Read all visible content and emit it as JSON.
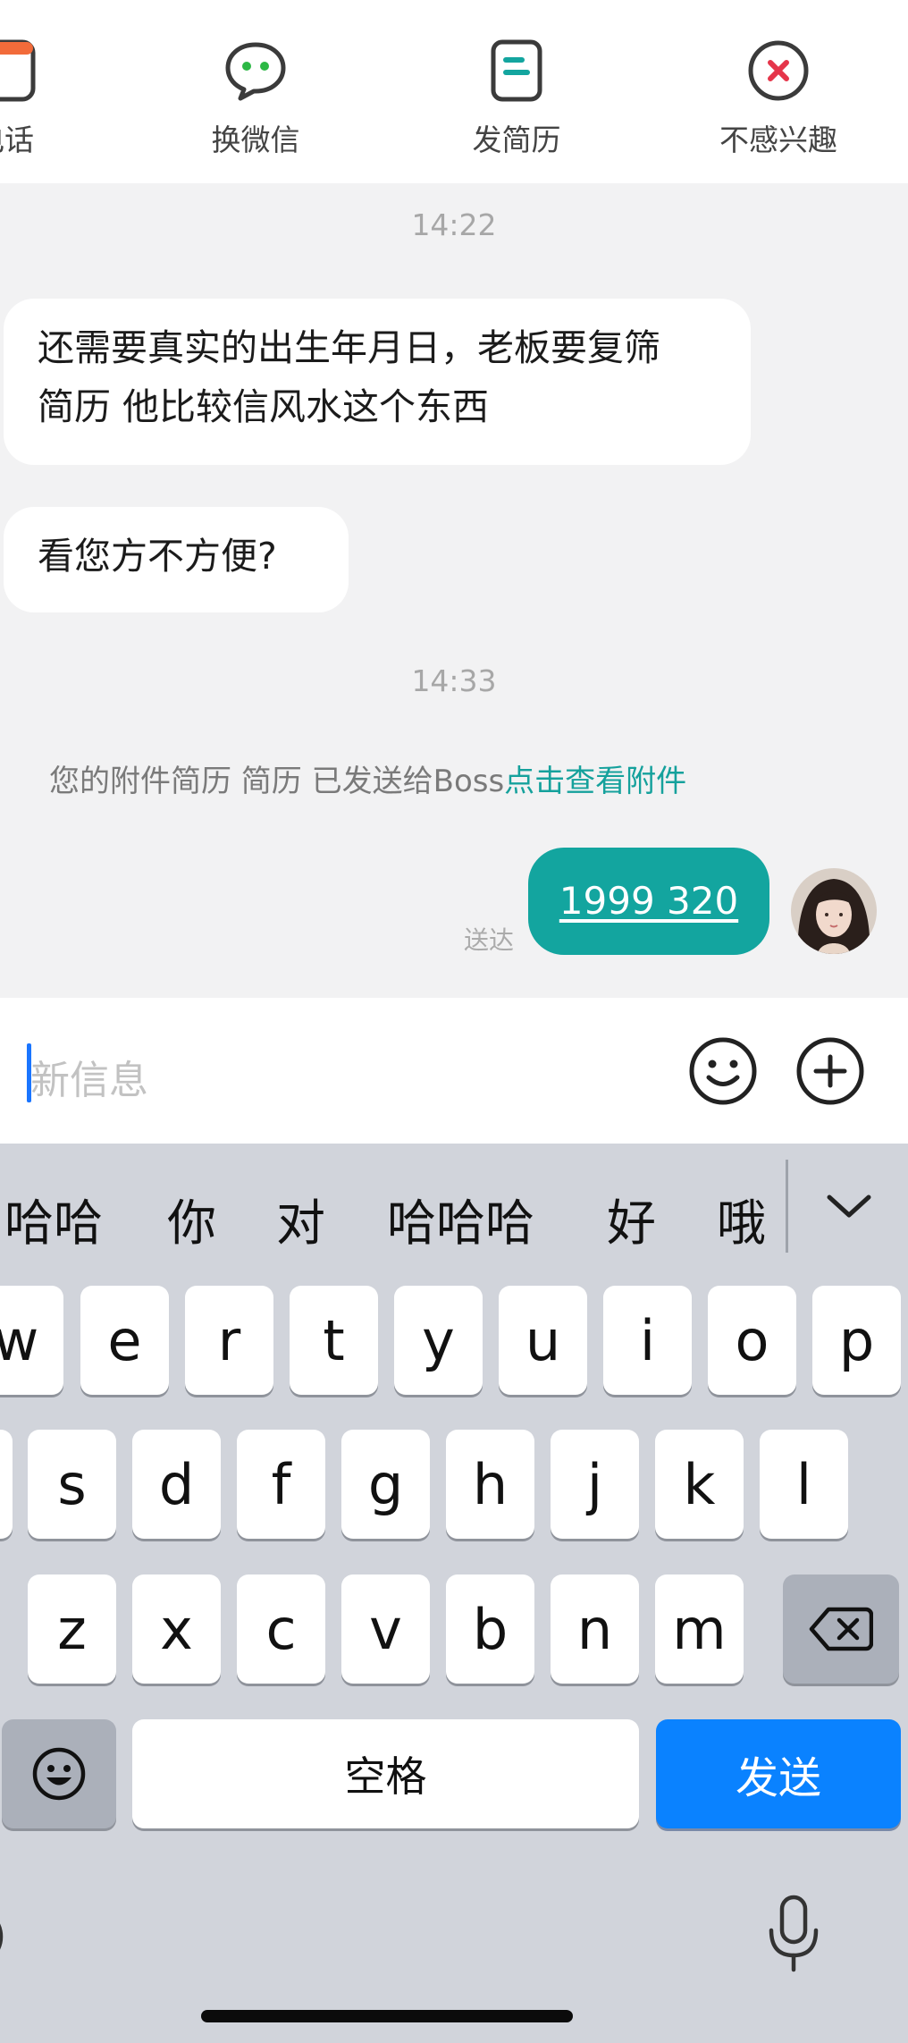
{
  "toolbar": {
    "items": [
      {
        "label": "电话"
      },
      {
        "label": "换微信"
      },
      {
        "label": "发简历"
      },
      {
        "label": "不感兴趣"
      }
    ]
  },
  "chat": {
    "time1": "14:22",
    "msg1_line1": "还需要真实的出生年月日，老板要复筛",
    "msg1_line2": "简历  他比较信风水这个东西",
    "msg2": "看您方不方便?",
    "time2": "14:33",
    "system_text": "您的附件简历 简历 已发送给Boss",
    "system_link": "点击查看附件",
    "my_msg": "1999 320",
    "my_status": "送达"
  },
  "input": {
    "placeholder": "新信息"
  },
  "keyboard": {
    "candidates": [
      "哈哈",
      "你",
      "对",
      "哈哈哈",
      "好",
      "哦"
    ],
    "row1": [
      "w",
      "e",
      "r",
      "t",
      "y",
      "u",
      "i",
      "o",
      "p"
    ],
    "row2": [
      "s",
      "d",
      "f",
      "g",
      "h",
      "j",
      "k",
      "l"
    ],
    "row3": [
      "z",
      "x",
      "c",
      "v",
      "b",
      "n",
      "m"
    ],
    "space_label": "空格",
    "send_label": "发送"
  },
  "colors": {
    "accent_teal": "#13a59f",
    "send_blue": "#0a82ff",
    "link_teal": "#15a19c"
  }
}
